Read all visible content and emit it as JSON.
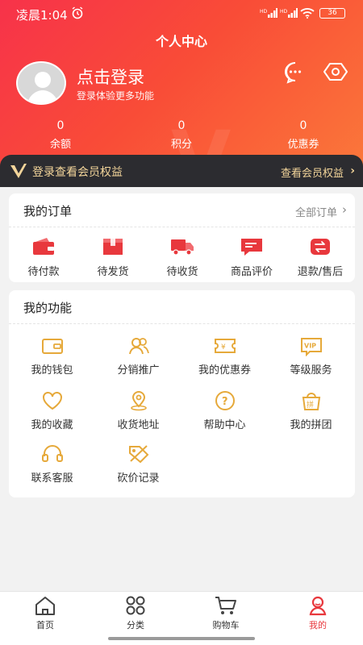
{
  "status_bar": {
    "time": "凌晨1:04",
    "battery": "36"
  },
  "header": {
    "title": "个人中心",
    "login_title": "点击登录",
    "login_subtitle": "登录体验更多功能",
    "stats": [
      {
        "value": "0",
        "label": "余额"
      },
      {
        "value": "0",
        "label": "积分"
      },
      {
        "value": "0",
        "label": "优惠券"
      }
    ]
  },
  "member_bar": {
    "left_text": "登录查看会员权益",
    "right_text": "查看会员权益"
  },
  "orders": {
    "title": "我的订单",
    "more": "全部订单",
    "items": [
      {
        "label": "待付款",
        "icon": "wallet-icon"
      },
      {
        "label": "待发货",
        "icon": "box-icon"
      },
      {
        "label": "待收货",
        "icon": "truck-icon"
      },
      {
        "label": "商品评价",
        "icon": "comment-icon"
      },
      {
        "label": "退款/售后",
        "icon": "refund-icon"
      }
    ]
  },
  "functions": {
    "title": "我的功能",
    "items": [
      {
        "label": "我的钱包",
        "icon": "wallet-icon"
      },
      {
        "label": "分销推广",
        "icon": "users-icon"
      },
      {
        "label": "我的优惠券",
        "icon": "coupon-icon"
      },
      {
        "label": "等级服务",
        "icon": "vip-icon"
      },
      {
        "label": "我的收藏",
        "icon": "heart-icon"
      },
      {
        "label": "收货地址",
        "icon": "location-icon"
      },
      {
        "label": "帮助中心",
        "icon": "help-icon"
      },
      {
        "label": "我的拼团",
        "icon": "group-buy-icon"
      },
      {
        "label": "联系客服",
        "icon": "headset-icon"
      },
      {
        "label": "砍价记录",
        "icon": "bargain-icon"
      }
    ]
  },
  "tabbar": {
    "items": [
      {
        "label": "首页",
        "icon": "home-icon"
      },
      {
        "label": "分类",
        "icon": "category-icon"
      },
      {
        "label": "购物车",
        "icon": "cart-icon"
      },
      {
        "label": "我的",
        "icon": "profile-icon"
      }
    ],
    "active_index": 3
  },
  "colors": {
    "accent": "#e8383d",
    "gold": "#e6a93a",
    "member_text": "#f3d59a"
  }
}
